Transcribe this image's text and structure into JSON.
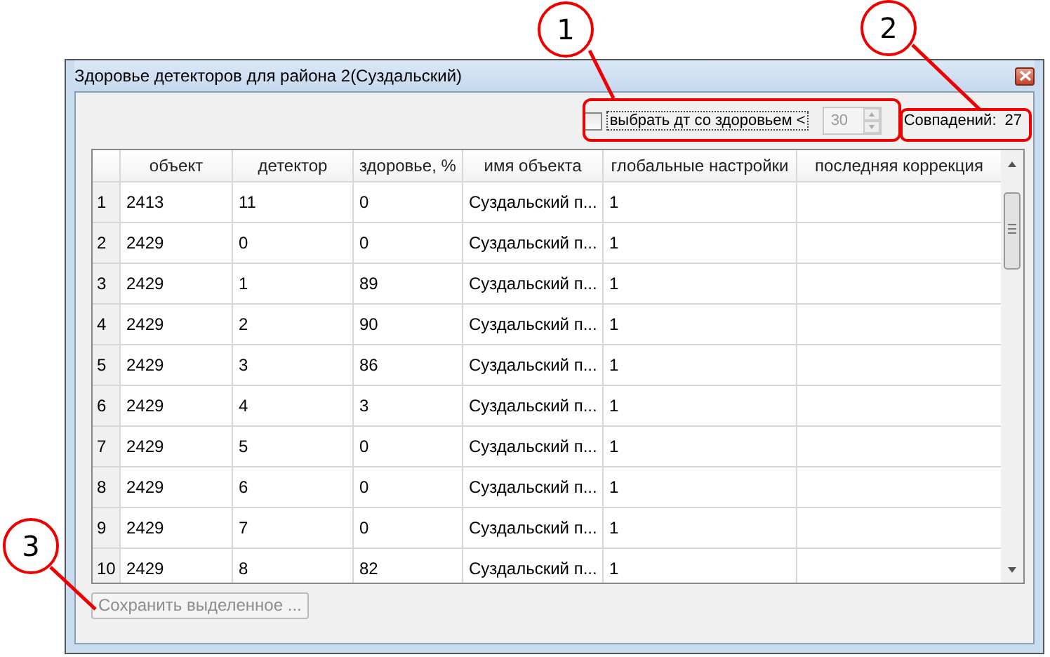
{
  "window": {
    "title": "Здоровье детекторов для района 2(Суздальский)"
  },
  "filter": {
    "label": "выбрать дт со здоровьем <",
    "checked": false,
    "value": "30",
    "disabled": true
  },
  "matches": {
    "label": "Совпадений:",
    "count": "27"
  },
  "table": {
    "columns": [
      "объект",
      "детектор",
      "здоровье, %",
      "имя объекта",
      "глобальные настройки",
      "последняя коррекция"
    ],
    "rows": [
      {
        "number": "1",
        "cells": [
          "2413",
          "11",
          "0",
          "Суздальский п...",
          "1",
          ""
        ]
      },
      {
        "number": "2",
        "cells": [
          "2429",
          "0",
          "0",
          "Суздальский п...",
          "1",
          ""
        ]
      },
      {
        "number": "3",
        "cells": [
          "2429",
          "1",
          "89",
          "Суздальский п...",
          "1",
          ""
        ]
      },
      {
        "number": "4",
        "cells": [
          "2429",
          "2",
          "90",
          "Суздальский п...",
          "1",
          ""
        ]
      },
      {
        "number": "5",
        "cells": [
          "2429",
          "3",
          "86",
          "Суздальский п...",
          "1",
          ""
        ]
      },
      {
        "number": "6",
        "cells": [
          "2429",
          "4",
          "3",
          "Суздальский п...",
          "1",
          ""
        ]
      },
      {
        "number": "7",
        "cells": [
          "2429",
          "5",
          "0",
          "Суздальский п...",
          "1",
          ""
        ]
      },
      {
        "number": "8",
        "cells": [
          "2429",
          "6",
          "0",
          "Суздальский п...",
          "1",
          ""
        ]
      },
      {
        "number": "9",
        "cells": [
          "2429",
          "7",
          "0",
          "Суздальский п...",
          "1",
          ""
        ]
      },
      {
        "number": "10",
        "cells": [
          "2429",
          "8",
          "82",
          "Суздальский п...",
          "1",
          ""
        ]
      }
    ]
  },
  "save_button": {
    "label": "Сохранить выделенное ...",
    "disabled": true
  },
  "callouts": [
    {
      "label": "1"
    },
    {
      "label": "2"
    },
    {
      "label": "3"
    }
  ]
}
